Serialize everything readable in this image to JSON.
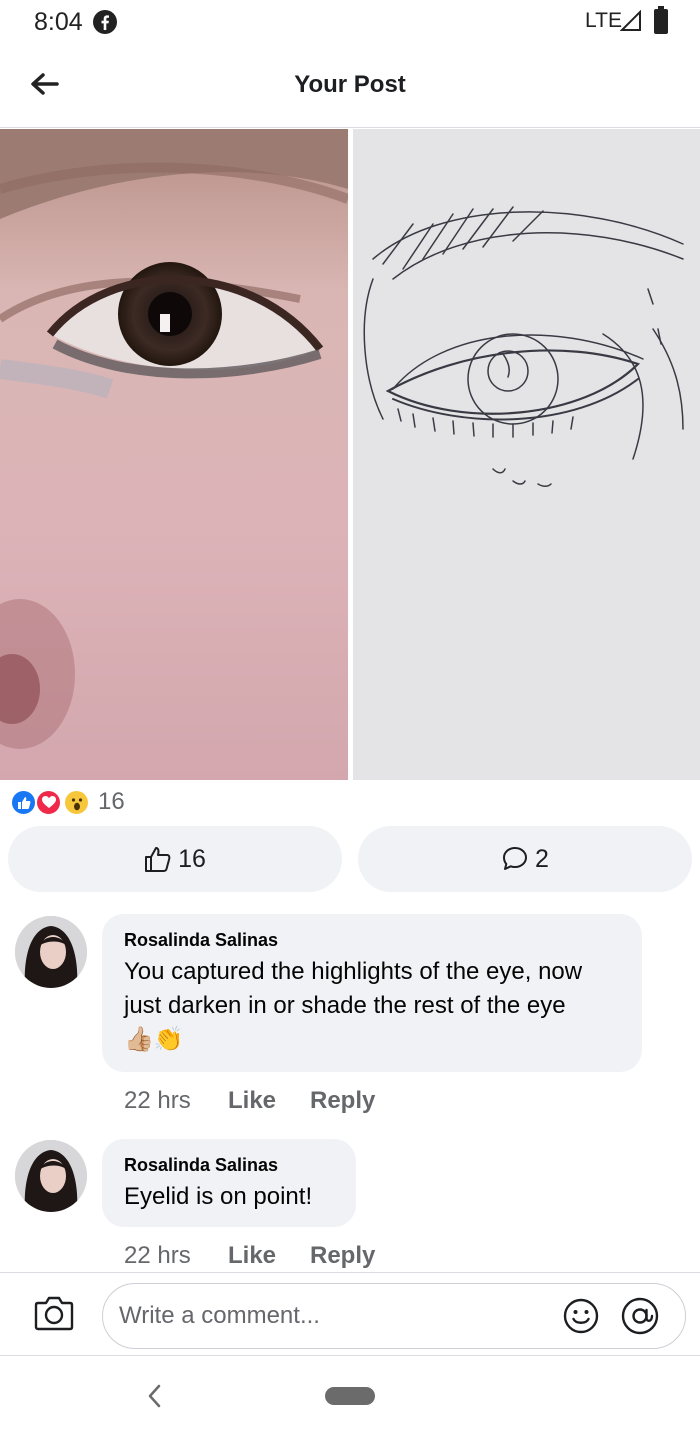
{
  "status_bar": {
    "time": "8:04",
    "network": "LTE",
    "app_icon": "facebook-icon"
  },
  "header": {
    "title": "Your Post",
    "back_icon": "arrow-left-icon"
  },
  "post": {
    "photos": [
      {
        "subject": "eye-photo",
        "icon": "photo"
      },
      {
        "subject": "eye-sketch",
        "icon": "photo"
      }
    ],
    "reactions": {
      "types": [
        "like",
        "love",
        "wow"
      ],
      "count": "16"
    },
    "like_button": {
      "count": "16",
      "icon": "thumbs-up-icon"
    },
    "comment_button": {
      "count": "2",
      "icon": "comment-icon"
    }
  },
  "comments": [
    {
      "author": "Rosalinda Salinas",
      "text": "You captured the highlights of the eye, now just darken in or shade the rest of the eye",
      "emoji": "👍🏼👏",
      "time": "22 hrs",
      "like_label": "Like",
      "reply_label": "Reply"
    },
    {
      "author": "Rosalinda Salinas",
      "text": "Eyelid is on point!",
      "time": "22 hrs",
      "like_label": "Like",
      "reply_label": "Reply"
    }
  ],
  "composer": {
    "placeholder": "Write a comment...",
    "camera_icon": "camera-icon",
    "emoji_icon": "smiley-icon",
    "mention_icon": "at-sign-icon"
  },
  "colors": {
    "accent": "#1877f2",
    "love": "#f0284a",
    "wow": "#f7c73b",
    "bubble": "#f0f2f5",
    "muted": "#65676b"
  }
}
